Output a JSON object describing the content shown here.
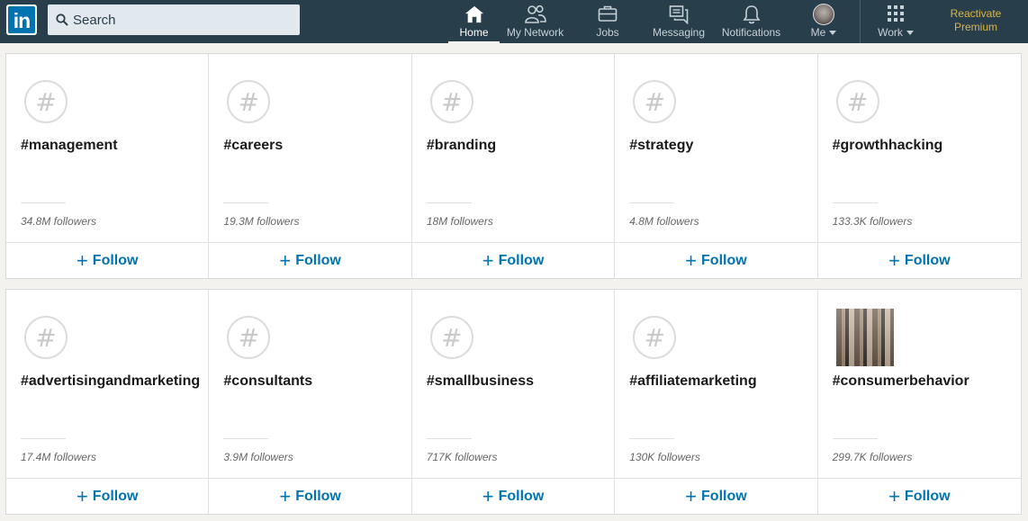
{
  "nav": {
    "logo_text": "in",
    "search_placeholder": "Search",
    "items": [
      {
        "label": "Home",
        "icon": "home-icon"
      },
      {
        "label": "My Network",
        "icon": "network-icon"
      },
      {
        "label": "Jobs",
        "icon": "briefcase-icon"
      },
      {
        "label": "Messaging",
        "icon": "messaging-icon"
      },
      {
        "label": "Notifications",
        "icon": "bell-icon"
      },
      {
        "label": "Me",
        "icon": "avatar"
      },
      {
        "label": "Work",
        "icon": "grid-icon"
      }
    ],
    "premium_line1": "Reactivate",
    "premium_line2": "Premium",
    "colors": {
      "bar": "#283e4a",
      "accent": "#0073b1",
      "premium": "#d9b54a"
    }
  },
  "follow_label": "Follow",
  "hashtags": [
    {
      "tag": "#management",
      "followers": "34.8M followers"
    },
    {
      "tag": "#careers",
      "followers": "19.3M followers"
    },
    {
      "tag": "#branding",
      "followers": "18M followers"
    },
    {
      "tag": "#strategy",
      "followers": "4.8M followers"
    },
    {
      "tag": "#growthhacking",
      "followers": "133.3K followers"
    },
    {
      "tag": "#advertisingandmarketing",
      "followers": "17.4M followers"
    },
    {
      "tag": "#consultants",
      "followers": "3.9M followers"
    },
    {
      "tag": "#smallbusiness",
      "followers": "717K followers"
    },
    {
      "tag": "#affiliatemarketing",
      "followers": "130K followers"
    },
    {
      "tag": "#consumerbehavior",
      "followers": "299.7K followers"
    }
  ]
}
